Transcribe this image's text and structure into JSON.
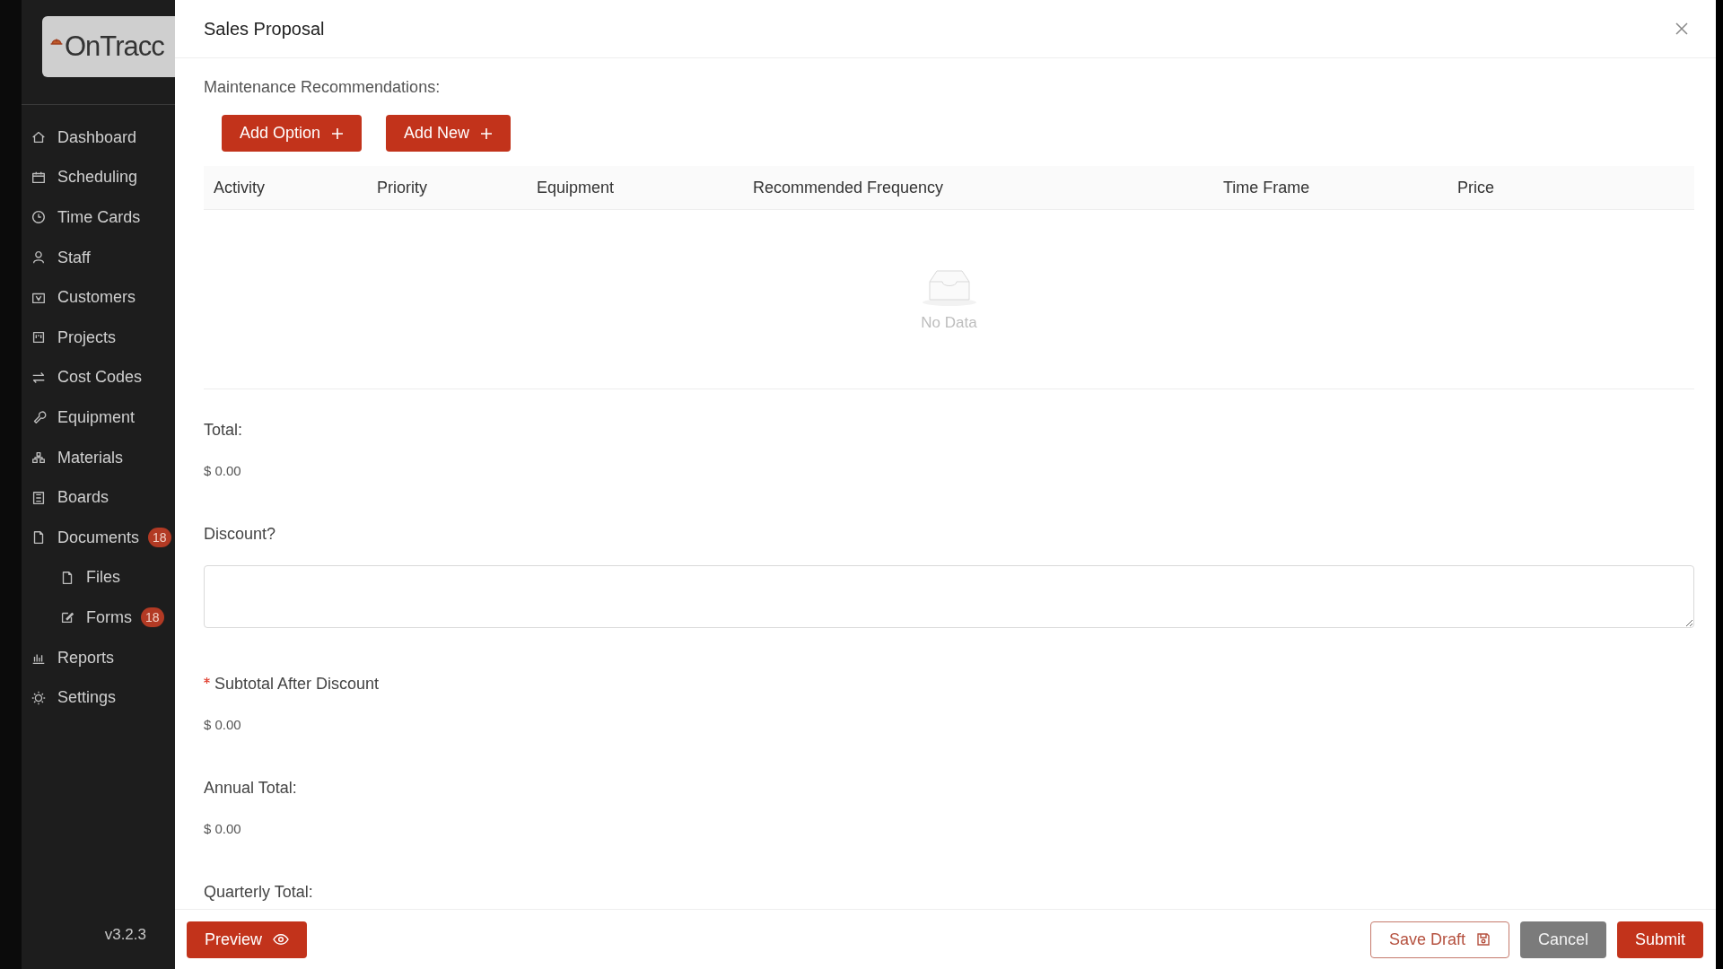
{
  "sidebar": {
    "logo": "OnTracc",
    "items": [
      {
        "label": "Dashboard"
      },
      {
        "label": "Scheduling"
      },
      {
        "label": "Time Cards"
      },
      {
        "label": "Staff"
      },
      {
        "label": "Customers"
      },
      {
        "label": "Projects"
      },
      {
        "label": "Cost Codes"
      },
      {
        "label": "Equipment"
      },
      {
        "label": "Materials"
      },
      {
        "label": "Boards"
      },
      {
        "label": "Documents",
        "badge": "18",
        "children": [
          {
            "label": "Files"
          },
          {
            "label": "Forms",
            "badge": "18"
          }
        ]
      },
      {
        "label": "Reports"
      },
      {
        "label": "Settings"
      }
    ],
    "version": "v3.2.3"
  },
  "modal": {
    "title": "Sales Proposal",
    "section_label": "Maintenance Recommendations:",
    "buttons": [
      {
        "label": "Add Option"
      },
      {
        "label": "Add New"
      }
    ],
    "table": {
      "columns": [
        "Activity",
        "Priority",
        "Equipment",
        "Recommended Frequency",
        "Time Frame",
        "Price"
      ],
      "empty_text": "No Data"
    },
    "fields": [
      {
        "kind": "amount",
        "label": "Total:",
        "value": "$ 0.00",
        "required": false
      },
      {
        "kind": "textarea",
        "label": "Discount?",
        "required": false
      },
      {
        "kind": "amount",
        "label": "Subtotal After Discount",
        "value": "$ 0.00",
        "required": true
      },
      {
        "kind": "amount",
        "label": "Annual Total:",
        "value": "$ 0.00",
        "required": false
      },
      {
        "kind": "amount",
        "label": "Quarterly Total:",
        "required": false
      }
    ],
    "footer": {
      "left": [
        {
          "kind": "preview",
          "label": "Preview"
        }
      ],
      "right": [
        {
          "kind": "draft",
          "label": "Save Draft"
        },
        {
          "kind": "cancel",
          "label": "Cancel"
        },
        {
          "kind": "submit",
          "label": "Submit"
        }
      ]
    }
  }
}
